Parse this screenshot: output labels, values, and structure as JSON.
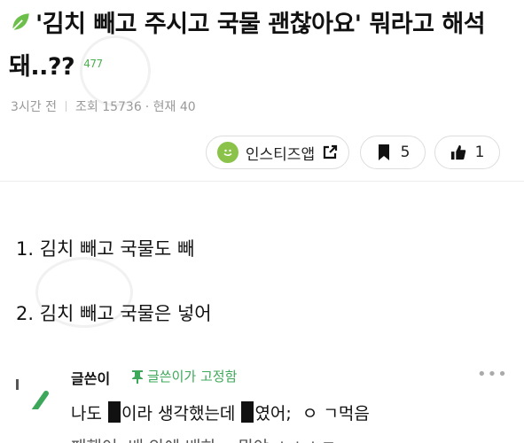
{
  "post": {
    "title": "'김치 빼고 주시고 국물 괜찮아요' 뭐라고 해석돼..??",
    "comment_count": "477",
    "time_ago": "3시간 전",
    "views": "조회 15736",
    "current": "· 현재 40"
  },
  "actions": {
    "app_label": "인스티즈앱",
    "bookmark_count": "5",
    "like_count": "1"
  },
  "content": {
    "line1": "1. 김치 빼고 국물도 빼",
    "line2": "2. 김치 빼고 국물은 넣어"
  },
  "comment": {
    "author": "글쓴이",
    "pinned_label": "글쓴이가 고정함",
    "more": "•••",
    "text_a": "나도 ",
    "text_b": "이라 생각했는데 ",
    "text_c": "였어; ",
    "text_d": "ㅇ ㄱ먹음",
    "text2": "패했어. 배 안에 배하... 뭐야 ㅎㅎㅎㅋ"
  },
  "colors": {
    "accent_green": "#3ea85a",
    "leaf_green": "#8bc34a"
  },
  "icons": [
    "leaf-icon",
    "smile-icon",
    "external-link-icon",
    "bookmark-icon",
    "thumbs-up-icon",
    "pin-icon",
    "more-icon"
  ]
}
